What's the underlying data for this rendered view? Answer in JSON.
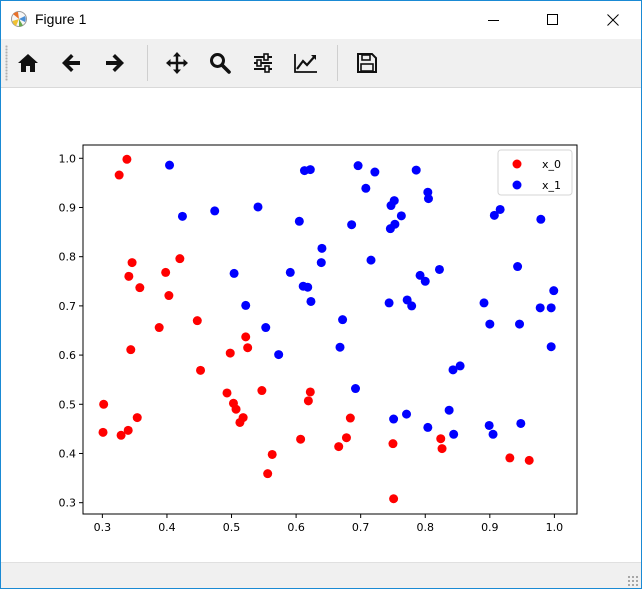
{
  "window": {
    "title": "Figure 1",
    "app_icon": "matplotlib-figure-icon",
    "controls": [
      {
        "name": "minimize-button",
        "icon": "minimize-icon"
      },
      {
        "name": "maximize-button",
        "icon": "maximize-icon"
      },
      {
        "name": "close-button",
        "icon": "close-icon"
      }
    ]
  },
  "toolbar": {
    "tools": [
      {
        "name": "home-button",
        "icon": "home-icon",
        "label": "Home"
      },
      {
        "name": "back-button",
        "icon": "arrow-left-icon",
        "label": "Back"
      },
      {
        "name": "forward-button",
        "icon": "arrow-right-icon",
        "label": "Forward"
      },
      {
        "name": "pan-button",
        "icon": "move-icon",
        "label": "Pan"
      },
      {
        "name": "zoom-button",
        "icon": "magnifier-icon",
        "label": "Zoom"
      },
      {
        "name": "subplots-button",
        "icon": "sliders-icon",
        "label": "Subplots"
      },
      {
        "name": "customize-button",
        "icon": "line-chart-icon",
        "label": "Customize"
      },
      {
        "name": "save-button",
        "icon": "floppy-disk-icon",
        "label": "Save"
      }
    ]
  },
  "colors": {
    "x_0": "#ff0000",
    "x_1": "#0000ff",
    "window_border": "#1a8ad4",
    "toolbar_bg": "#f0f0f0"
  },
  "chart_data": {
    "type": "scatter",
    "title": "",
    "xlabel": "",
    "ylabel": "",
    "xlim": [
      0.27,
      1.035
    ],
    "ylim": [
      0.277,
      1.027
    ],
    "xticks": [
      "0.3",
      "0.4",
      "0.5",
      "0.6",
      "0.7",
      "0.8",
      "0.9",
      "1.0"
    ],
    "yticks": [
      "0.3",
      "0.4",
      "0.5",
      "0.6",
      "0.7",
      "0.8",
      "0.9",
      "1.0"
    ],
    "grid": false,
    "legend_position": "top-right",
    "series": [
      {
        "name": "x_0",
        "points": [
          [
            0.338,
            0.998
          ],
          [
            0.326,
            0.966
          ],
          [
            0.346,
            0.788
          ],
          [
            0.398,
            0.768
          ],
          [
            0.42,
            0.796
          ],
          [
            0.341,
            0.76
          ],
          [
            0.358,
            0.737
          ],
          [
            0.403,
            0.721
          ],
          [
            0.447,
            0.67
          ],
          [
            0.388,
            0.656
          ],
          [
            0.522,
            0.637
          ],
          [
            0.498,
            0.604
          ],
          [
            0.525,
            0.615
          ],
          [
            0.344,
            0.611
          ],
          [
            0.452,
            0.569
          ],
          [
            0.547,
            0.528
          ],
          [
            0.493,
            0.523
          ],
          [
            0.302,
            0.5
          ],
          [
            0.503,
            0.502
          ],
          [
            0.507,
            0.49
          ],
          [
            0.518,
            0.473
          ],
          [
            0.513,
            0.463
          ],
          [
            0.354,
            0.473
          ],
          [
            0.301,
            0.443
          ],
          [
            0.329,
            0.437
          ],
          [
            0.34,
            0.447
          ],
          [
            0.607,
            0.429
          ],
          [
            0.563,
            0.398
          ],
          [
            0.556,
            0.359
          ],
          [
            0.619,
            0.507
          ],
          [
            0.622,
            0.525
          ],
          [
            0.684,
            0.472
          ],
          [
            0.678,
            0.432
          ],
          [
            0.666,
            0.414
          ],
          [
            0.75,
            0.42
          ],
          [
            0.824,
            0.43
          ],
          [
            0.826,
            0.41
          ],
          [
            0.931,
            0.391
          ],
          [
            0.961,
            0.386
          ],
          [
            0.751,
            0.308
          ]
        ]
      },
      {
        "name": "x_1",
        "points": [
          [
            0.404,
            0.986
          ],
          [
            0.424,
            0.882
          ],
          [
            0.474,
            0.893
          ],
          [
            0.541,
            0.901
          ],
          [
            0.613,
            0.975
          ],
          [
            0.622,
            0.977
          ],
          [
            0.696,
            0.985
          ],
          [
            0.722,
            0.972
          ],
          [
            0.786,
            0.976
          ],
          [
            0.708,
            0.939
          ],
          [
            0.804,
            0.931
          ],
          [
            0.805,
            0.918
          ],
          [
            0.752,
            0.914
          ],
          [
            0.747,
            0.904
          ],
          [
            0.763,
            0.883
          ],
          [
            0.753,
            0.866
          ],
          [
            0.746,
            0.857
          ],
          [
            0.686,
            0.865
          ],
          [
            0.605,
            0.872
          ],
          [
            0.64,
            0.817
          ],
          [
            0.639,
            0.788
          ],
          [
            0.716,
            0.793
          ],
          [
            0.822,
            0.774
          ],
          [
            0.591,
            0.768
          ],
          [
            0.504,
            0.766
          ],
          [
            0.611,
            0.74
          ],
          [
            0.618,
            0.738
          ],
          [
            0.792,
            0.762
          ],
          [
            0.8,
            0.75
          ],
          [
            0.623,
            0.709
          ],
          [
            0.522,
            0.701
          ],
          [
            0.772,
            0.712
          ],
          [
            0.779,
            0.7
          ],
          [
            0.744,
            0.706
          ],
          [
            0.672,
            0.672
          ],
          [
            0.553,
            0.656
          ],
          [
            0.573,
            0.601
          ],
          [
            0.668,
            0.616
          ],
          [
            0.854,
            0.578
          ],
          [
            0.843,
            0.57
          ],
          [
            0.692,
            0.532
          ],
          [
            0.9,
            0.663
          ],
          [
            0.946,
            0.663
          ],
          [
            0.891,
            0.706
          ],
          [
            0.916,
            0.896
          ],
          [
            0.907,
            0.884
          ],
          [
            0.979,
            0.876
          ],
          [
            0.943,
            0.78
          ],
          [
            0.999,
            0.731
          ],
          [
            0.978,
            0.696
          ],
          [
            0.995,
            0.696
          ],
          [
            0.995,
            0.617
          ],
          [
            0.837,
            0.488
          ],
          [
            0.771,
            0.48
          ],
          [
            0.751,
            0.47
          ],
          [
            0.804,
            0.453
          ],
          [
            0.844,
            0.439
          ],
          [
            0.899,
            0.457
          ],
          [
            0.905,
            0.439
          ],
          [
            0.948,
            0.461
          ]
        ]
      }
    ]
  }
}
